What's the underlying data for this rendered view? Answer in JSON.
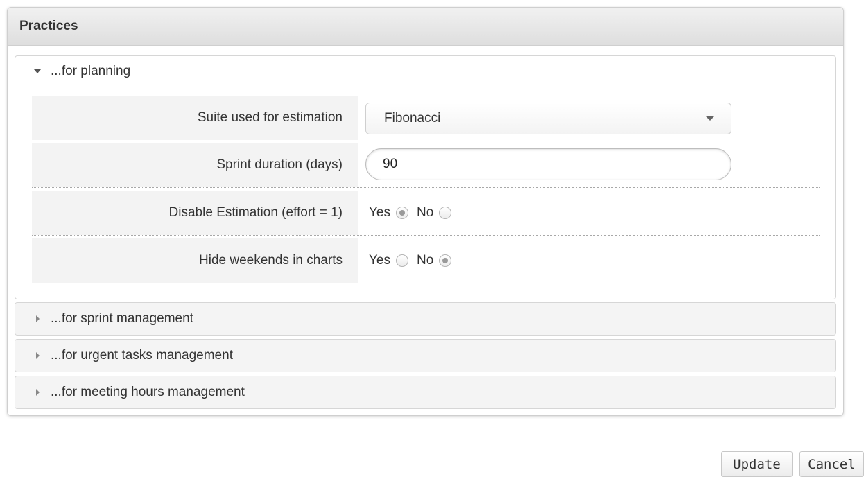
{
  "panel": {
    "title": "Practices"
  },
  "sections": [
    {
      "label": "...for planning",
      "expanded": true,
      "fields": {
        "estimation_suite": {
          "label": "Suite used for estimation",
          "value": "Fibonacci"
        },
        "sprint_duration": {
          "label": "Sprint duration (days)",
          "value": "90"
        },
        "disable_estimation": {
          "label": "Disable Estimation (effort = 1)",
          "yes_label": "Yes",
          "no_label": "No",
          "selected": "Yes"
        },
        "hide_weekends": {
          "label": "Hide weekends in charts",
          "yes_label": "Yes",
          "no_label": "No",
          "selected": "No"
        }
      }
    },
    {
      "label": "...for sprint management",
      "expanded": false
    },
    {
      "label": "...for urgent tasks management",
      "expanded": false
    },
    {
      "label": "...for meeting hours management",
      "expanded": false
    }
  ],
  "actions": {
    "update_label": "Update",
    "cancel_label": "Cancel"
  },
  "icons": {
    "expanded": "triangle-down-icon",
    "collapsed": "triangle-right-icon",
    "dropdown": "chevron-down-icon"
  }
}
